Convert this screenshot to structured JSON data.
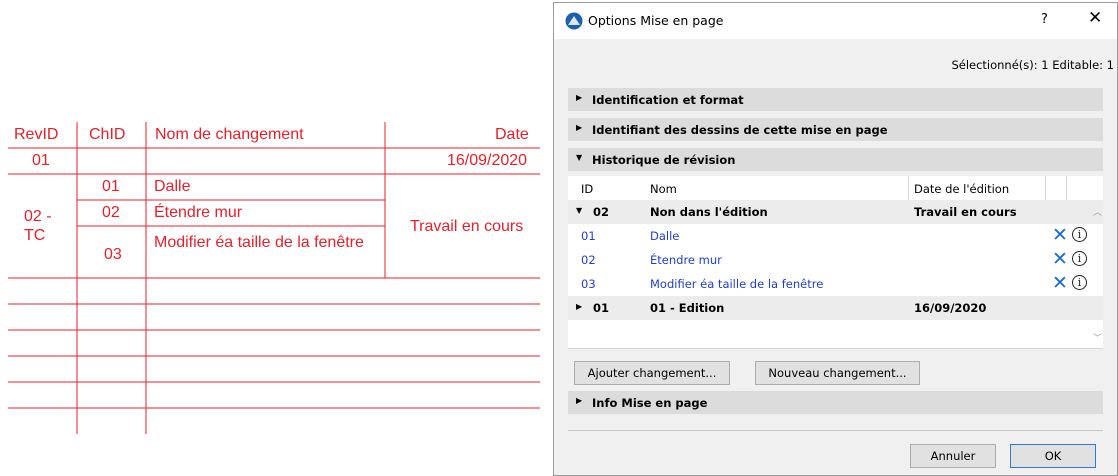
{
  "drawing": {
    "headers": {
      "revid": "RevID",
      "chid": "ChID",
      "nom": "Nom de changement",
      "date": "Date"
    },
    "rev01": {
      "id": "01",
      "date": "16/09/2020"
    },
    "rev02": {
      "id": "02 -\nTC",
      "status": "Travail en cours"
    },
    "changes": [
      {
        "id": "01",
        "name": "Dalle"
      },
      {
        "id": "02",
        "name": "Étendre mur"
      },
      {
        "id": "03",
        "name": "Modifier éa taille de la fenêtre"
      }
    ],
    "line_color": "#e8202a"
  },
  "dialog": {
    "title": "Options Mise en page",
    "help": "?",
    "close": "✕",
    "selection_info": "Sélectionné(s): 1 Editable: 1",
    "sections": {
      "identification": "Identification et format",
      "drawing_ids": "Identifiant des dessins de cette mise en page",
      "history": "Historique de révision",
      "info": "Info Mise en page"
    },
    "table": {
      "headers": {
        "id": "ID",
        "nom": "Nom",
        "date": "Date de l'édition"
      },
      "group02": {
        "id": "02",
        "nom": "Non dans l'édition",
        "date": "Travail en cours"
      },
      "changes": [
        {
          "id": "01",
          "nom": "Dalle"
        },
        {
          "id": "02",
          "nom": "Étendre mur"
        },
        {
          "id": "03",
          "nom": "Modifier éa taille de la fenêtre"
        }
      ],
      "group01": {
        "id": "01",
        "nom": "01 - Edition",
        "date": "16/09/2020"
      }
    },
    "buttons": {
      "add_change": "Ajouter changement...",
      "new_change": "Nouveau changement...",
      "cancel": "Annuler",
      "ok": "OK"
    },
    "accent_color": "#1f3fd0"
  }
}
